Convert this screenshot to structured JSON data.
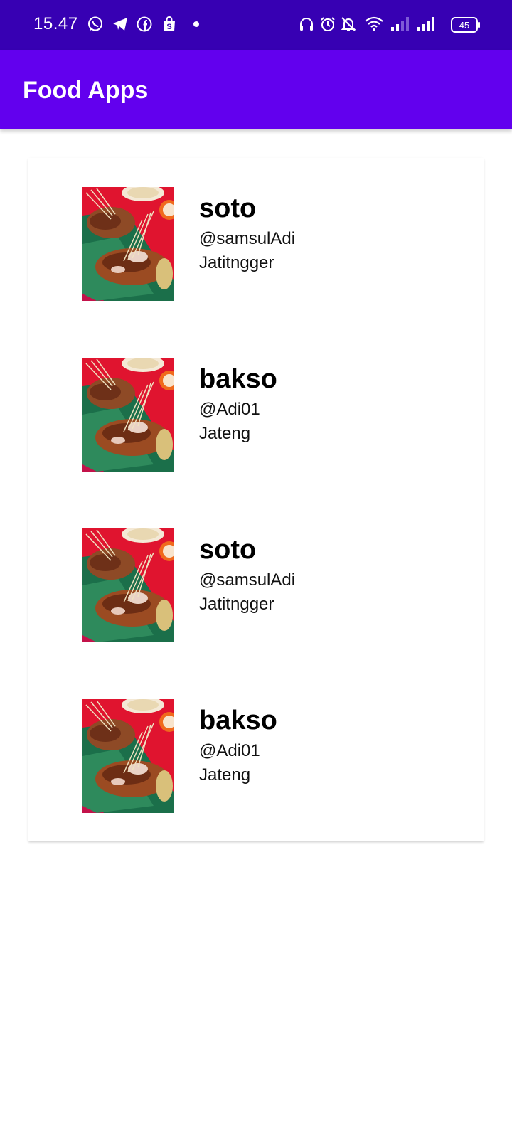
{
  "status_bar": {
    "time": "15.47",
    "battery": "45",
    "icons": [
      "whatsapp-icon",
      "telegram-icon",
      "facebook-icon",
      "shopee-icon",
      "dot-icon",
      "headphones-icon",
      "alarm-icon",
      "bell-off-icon",
      "wifi-icon",
      "signal-icon",
      "signal-icon",
      "battery-icon"
    ]
  },
  "app_bar": {
    "title": "Food Apps"
  },
  "colors": {
    "status_bar": "#3700b3",
    "app_bar": "#6200ee",
    "background": "#ffffff"
  },
  "foods": [
    {
      "name": "soto",
      "user": "@samsulAdi",
      "location": "Jatitngger"
    },
    {
      "name": "bakso",
      "user": "@Adi01",
      "location": "Jateng"
    },
    {
      "name": "soto",
      "user": "@samsulAdi",
      "location": "Jatitngger"
    },
    {
      "name": "bakso",
      "user": "@Adi01",
      "location": "Jateng"
    }
  ]
}
